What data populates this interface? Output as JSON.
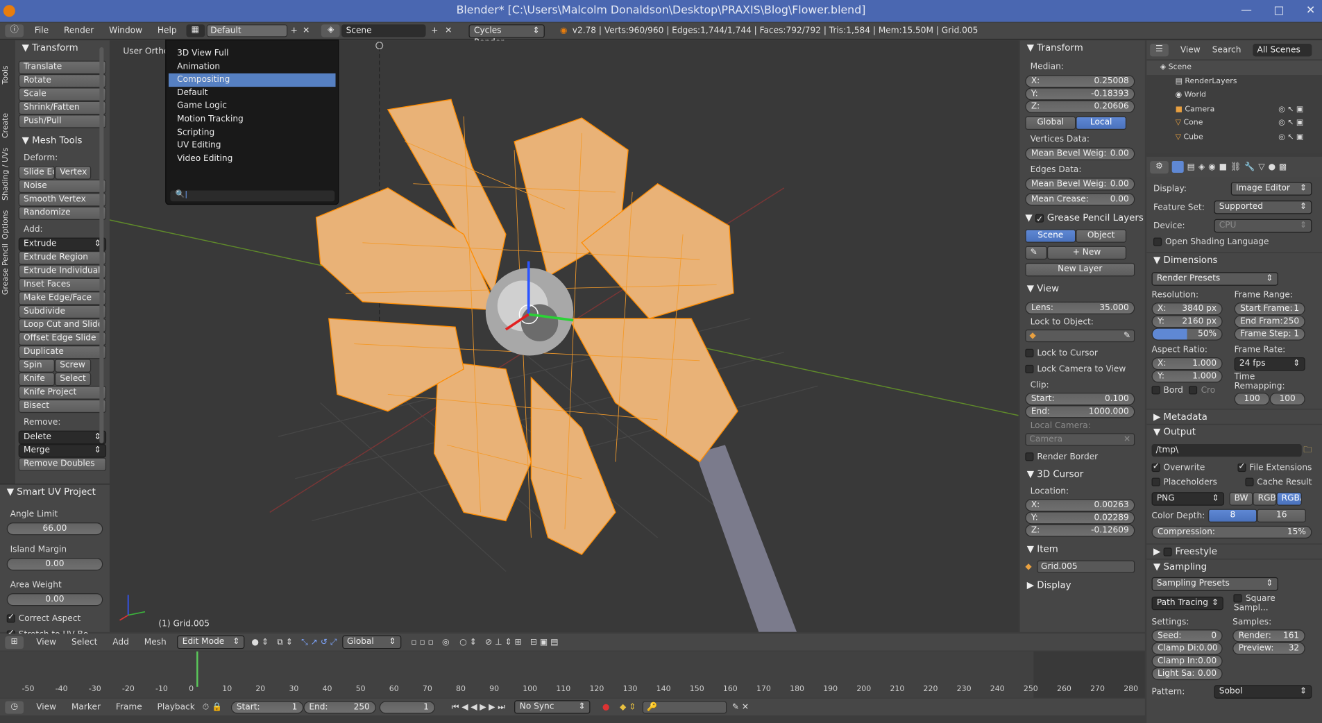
{
  "window": {
    "title": "Blender* [C:\\Users\\Malcolm Donaldson\\Desktop\\PRAXIS\\Blog\\Flower.blend]",
    "controls": [
      "—",
      "□",
      "✕"
    ]
  },
  "info_header": {
    "menus": [
      "File",
      "Render",
      "Window",
      "Help"
    ],
    "screen_layout": "Default",
    "scene": "Scene",
    "engine": "Cycles Render",
    "stats": "v2.78 | Verts:960/960 | Edges:1,744/1,744 | Faces:792/792 | Tris:1,584 | Mem:15.50M | Grid.005"
  },
  "layout_menu": {
    "items": [
      "3D View Full",
      "Animation",
      "Compositing",
      "Default",
      "Game Logic",
      "Motion Tracking",
      "Scripting",
      "UV Editing",
      "Video Editing"
    ],
    "selected": "Compositing",
    "search_value": ""
  },
  "tool_tabs": [
    "Tools",
    "Create",
    "Shading / UVs",
    "Options",
    "Grease Pencil"
  ],
  "toolshelf": {
    "transform_header": "Transform",
    "transform_buttons": [
      "Translate",
      "Rotate",
      "Scale",
      "Shrink/Fatten",
      "Push/Pull"
    ],
    "mesh_tools_header": "Mesh Tools",
    "deform_label": "Deform:",
    "deform_row": [
      "Slide Ed",
      "Vertex"
    ],
    "deform_buttons": [
      "Noise",
      "Smooth Vertex",
      "Randomize"
    ],
    "add_label": "Add:",
    "extrude": "Extrude",
    "add_buttons": [
      "Extrude Region",
      "Extrude Individual",
      "Inset Faces",
      "Make Edge/Face",
      "Subdivide",
      "Loop Cut and Slide",
      "Offset Edge Slide",
      "Duplicate"
    ],
    "spin_row": [
      "Spin",
      "Screw"
    ],
    "knife_row": [
      "Knife",
      "Select"
    ],
    "add_buttons2": [
      "Knife Project",
      "Bisect"
    ],
    "remove_label": "Remove:",
    "delete": "Delete",
    "merge": "Merge",
    "remove_doubles": "Remove Doubles"
  },
  "operator": {
    "header": "Smart UV Project",
    "angle_limit_label": "Angle Limit",
    "angle_limit": "66.00",
    "island_margin_label": "Island Margin",
    "island_margin": "0.00",
    "area_weight_label": "Area Weight",
    "area_weight": "0.00",
    "correct_aspect": "Correct Aspect",
    "stretch": "Stretch to UV Bo..."
  },
  "viewport": {
    "view_name": "User Ortho",
    "object_label": "(1) Grid.005",
    "colors": {
      "mesh": "#f0a030",
      "wire": "#ff8c00",
      "grid": "#4a4a4a",
      "x_axis": "#8b3a3a",
      "y_axis": "#5a8a2a"
    }
  },
  "view3d_header": {
    "menus": [
      "View",
      "Select",
      "Add",
      "Mesh"
    ],
    "mode": "Edit Mode",
    "orientation": "Global"
  },
  "properties_n": {
    "transform_header": "Transform",
    "median_label": "Median:",
    "x": [
      "X:",
      "0.25008"
    ],
    "y": [
      "Y:",
      "-0.18393"
    ],
    "z": [
      "Z:",
      "0.20606"
    ],
    "global": "Global",
    "local": "Local",
    "vertices_data": "Vertices Data:",
    "mean_bevel_v": [
      "Mean Bevel Weig:",
      "0.00"
    ],
    "edges_data": "Edges Data:",
    "mean_bevel_e": [
      "Mean Bevel Weig:",
      "0.00"
    ],
    "mean_crease": [
      "Mean Crease:",
      "0.00"
    ],
    "grease_header": "Grease Pencil Layers",
    "scene_tab": "Scene",
    "object_tab": "Object",
    "new": "New",
    "new_layer": "New Layer",
    "view_header": "View",
    "lens": [
      "Lens:",
      "35.000"
    ],
    "lock_object": "Lock to Object:",
    "lock_cursor": "Lock to Cursor",
    "lock_camera": "Lock Camera to View",
    "clip": "Clip:",
    "clip_start": [
      "Start:",
      "0.100"
    ],
    "clip_end": [
      "End:",
      "1000.000"
    ],
    "local_camera": "Local Camera:",
    "camera": "Camera",
    "render_border": "Render Border",
    "cursor_header": "3D Cursor",
    "location": "Location:",
    "cx": [
      "X:",
      "0.00263"
    ],
    "cy": [
      "Y:",
      "0.02289"
    ],
    "cz": [
      "Z:",
      "-0.12609"
    ],
    "item_header": "Item",
    "item_name": "Grid.005",
    "display_header": "Display"
  },
  "outliner": {
    "menus": [
      "View",
      "Search"
    ],
    "filter": "All Scenes",
    "items": [
      "Scene",
      "RenderLayers",
      "World",
      "Camera",
      "Cone",
      "Cube"
    ]
  },
  "render_props": {
    "display_label": "Display:",
    "display": "Image Editor",
    "feature_label": "Feature Set:",
    "feature": "Supported",
    "device_label": "Device:",
    "device": "CPU",
    "osl": "Open Shading Language",
    "dimensions_header": "Dimensions",
    "render_presets": "Render Presets",
    "resolution_label": "Resolution:",
    "res_x": [
      "X:",
      "3840 px"
    ],
    "res_y": [
      "Y:",
      "2160 px"
    ],
    "res_pct": "50%",
    "frame_range_label": "Frame Range:",
    "start_frame": [
      "Start Frame:",
      "1"
    ],
    "end_frame": [
      "End Fram:",
      "250"
    ],
    "frame_step": [
      "Frame Step:",
      "1"
    ],
    "aspect_label": "Aspect Ratio:",
    "asp_x": [
      "X:",
      "1.000"
    ],
    "asp_y": [
      "Y:",
      "1.000"
    ],
    "frame_rate_label": "Frame Rate:",
    "fps": "24 fps",
    "time_remap": "Time Remapping:",
    "remap_old": "100",
    "remap_new": "100",
    "bord": "Bord",
    "cro": "Cro",
    "metadata_header": "Metadata",
    "output_header": "Output",
    "output_path": "/tmp\\",
    "overwrite": "Overwrite",
    "file_ext": "File Extensions",
    "placeholders": "Placeholders",
    "cache": "Cache Result",
    "format": "PNG",
    "bw": "BW",
    "rgb": "RGB",
    "rgba": "RGBA",
    "color_depth_label": "Color Depth:",
    "depth8": "8",
    "depth16": "16",
    "compression": [
      "Compression:",
      "15%"
    ],
    "freestyle_header": "Freestyle",
    "sampling_header": "Sampling",
    "sampling_presets": "Sampling Presets",
    "integrator": "Path Tracing",
    "square": "Square Sampl...",
    "settings_label": "Settings:",
    "seed": [
      "Seed:",
      "0"
    ],
    "clamp_d": [
      "Clamp Di:",
      "0.00"
    ],
    "clamp_i": [
      "Clamp In:",
      "0.00"
    ],
    "light_sa": [
      "Light Sa:",
      "0.00"
    ],
    "samples_label": "Samples:",
    "render_samples": [
      "Render:",
      "161"
    ],
    "preview_samples": [
      "Preview:",
      "32"
    ],
    "pattern_label": "Pattern:",
    "pattern": "Sobol"
  },
  "timeline": {
    "ticks": [
      "-50",
      "-40",
      "-30",
      "-20",
      "-10",
      "0",
      "10",
      "20",
      "30",
      "40",
      "50",
      "60",
      "70",
      "80",
      "90",
      "100",
      "110",
      "120",
      "130",
      "140",
      "150",
      "160",
      "170",
      "180",
      "190",
      "200",
      "210",
      "220",
      "230",
      "240",
      "250",
      "260",
      "270",
      "280"
    ],
    "current_frame": "1",
    "menus": [
      "View",
      "Marker",
      "Frame",
      "Playback"
    ],
    "start": [
      "Start:",
      "1"
    ],
    "end": [
      "End:",
      "250"
    ],
    "sync": "No Sync"
  }
}
